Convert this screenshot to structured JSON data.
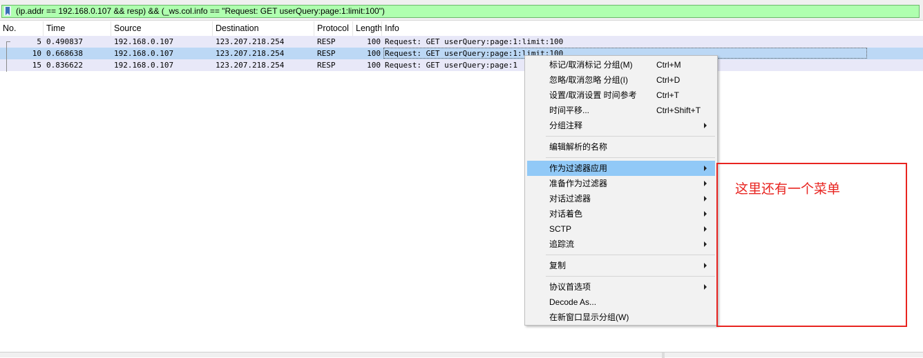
{
  "filter": {
    "text": "(ip.addr == 192.168.0.107 && resp) && (_ws.col.info == \"Request: GET userQuery:page:1:limit:100\")"
  },
  "columns": [
    "No.",
    "Time",
    "Source",
    "Destination",
    "Protocol",
    "Length",
    "Info"
  ],
  "packets": [
    {
      "no": "5",
      "time": "0.490837",
      "source": "192.168.0.107",
      "destination": "123.207.218.254",
      "protocol": "RESP",
      "length": "100",
      "info": "Request: GET userQuery:page:1:limit:100"
    },
    {
      "no": "10",
      "time": "0.668638",
      "source": "192.168.0.107",
      "destination": "123.207.218.254",
      "protocol": "RESP",
      "length": "100",
      "info": "Request: GET userQuery:page:1:limit:100"
    },
    {
      "no": "15",
      "time": "0.836622",
      "source": "192.168.0.107",
      "destination": "123.207.218.254",
      "protocol": "RESP",
      "length": "100",
      "info": "Request: GET userQuery:page:1"
    }
  ],
  "menu": {
    "items": [
      {
        "label": "标记/取消标记 分组(M)",
        "shortcut": "Ctrl+M"
      },
      {
        "label": "忽略/取消忽略 分组(I)",
        "shortcut": "Ctrl+D"
      },
      {
        "label": "设置/取消设置 时间参考",
        "shortcut": "Ctrl+T"
      },
      {
        "label": "时间平移...",
        "shortcut": "Ctrl+Shift+T"
      },
      {
        "label": "分组注释",
        "shortcut": ""
      },
      {
        "label": "编辑解析的名称",
        "shortcut": ""
      },
      {
        "label": "作为过滤器应用",
        "shortcut": ""
      },
      {
        "label": "准备作为过滤器",
        "shortcut": ""
      },
      {
        "label": "对话过滤器",
        "shortcut": ""
      },
      {
        "label": "对话着色",
        "shortcut": ""
      },
      {
        "label": "SCTP",
        "shortcut": ""
      },
      {
        "label": "追踪流",
        "shortcut": ""
      },
      {
        "label": "复制",
        "shortcut": ""
      },
      {
        "label": "协议首选项",
        "shortcut": ""
      },
      {
        "label": "Decode As...",
        "shortcut": ""
      },
      {
        "label": "在新窗口显示分组(W)",
        "shortcut": ""
      }
    ]
  },
  "annotation": {
    "text": "这里还有一个菜单",
    "color": "#e8231f"
  },
  "colors": {
    "filter_bg": "#afffaf",
    "row_bg": "#e8e8f8",
    "row_selected_bg": "#bcd8f5",
    "menu_highlight": "#91c9f7"
  }
}
